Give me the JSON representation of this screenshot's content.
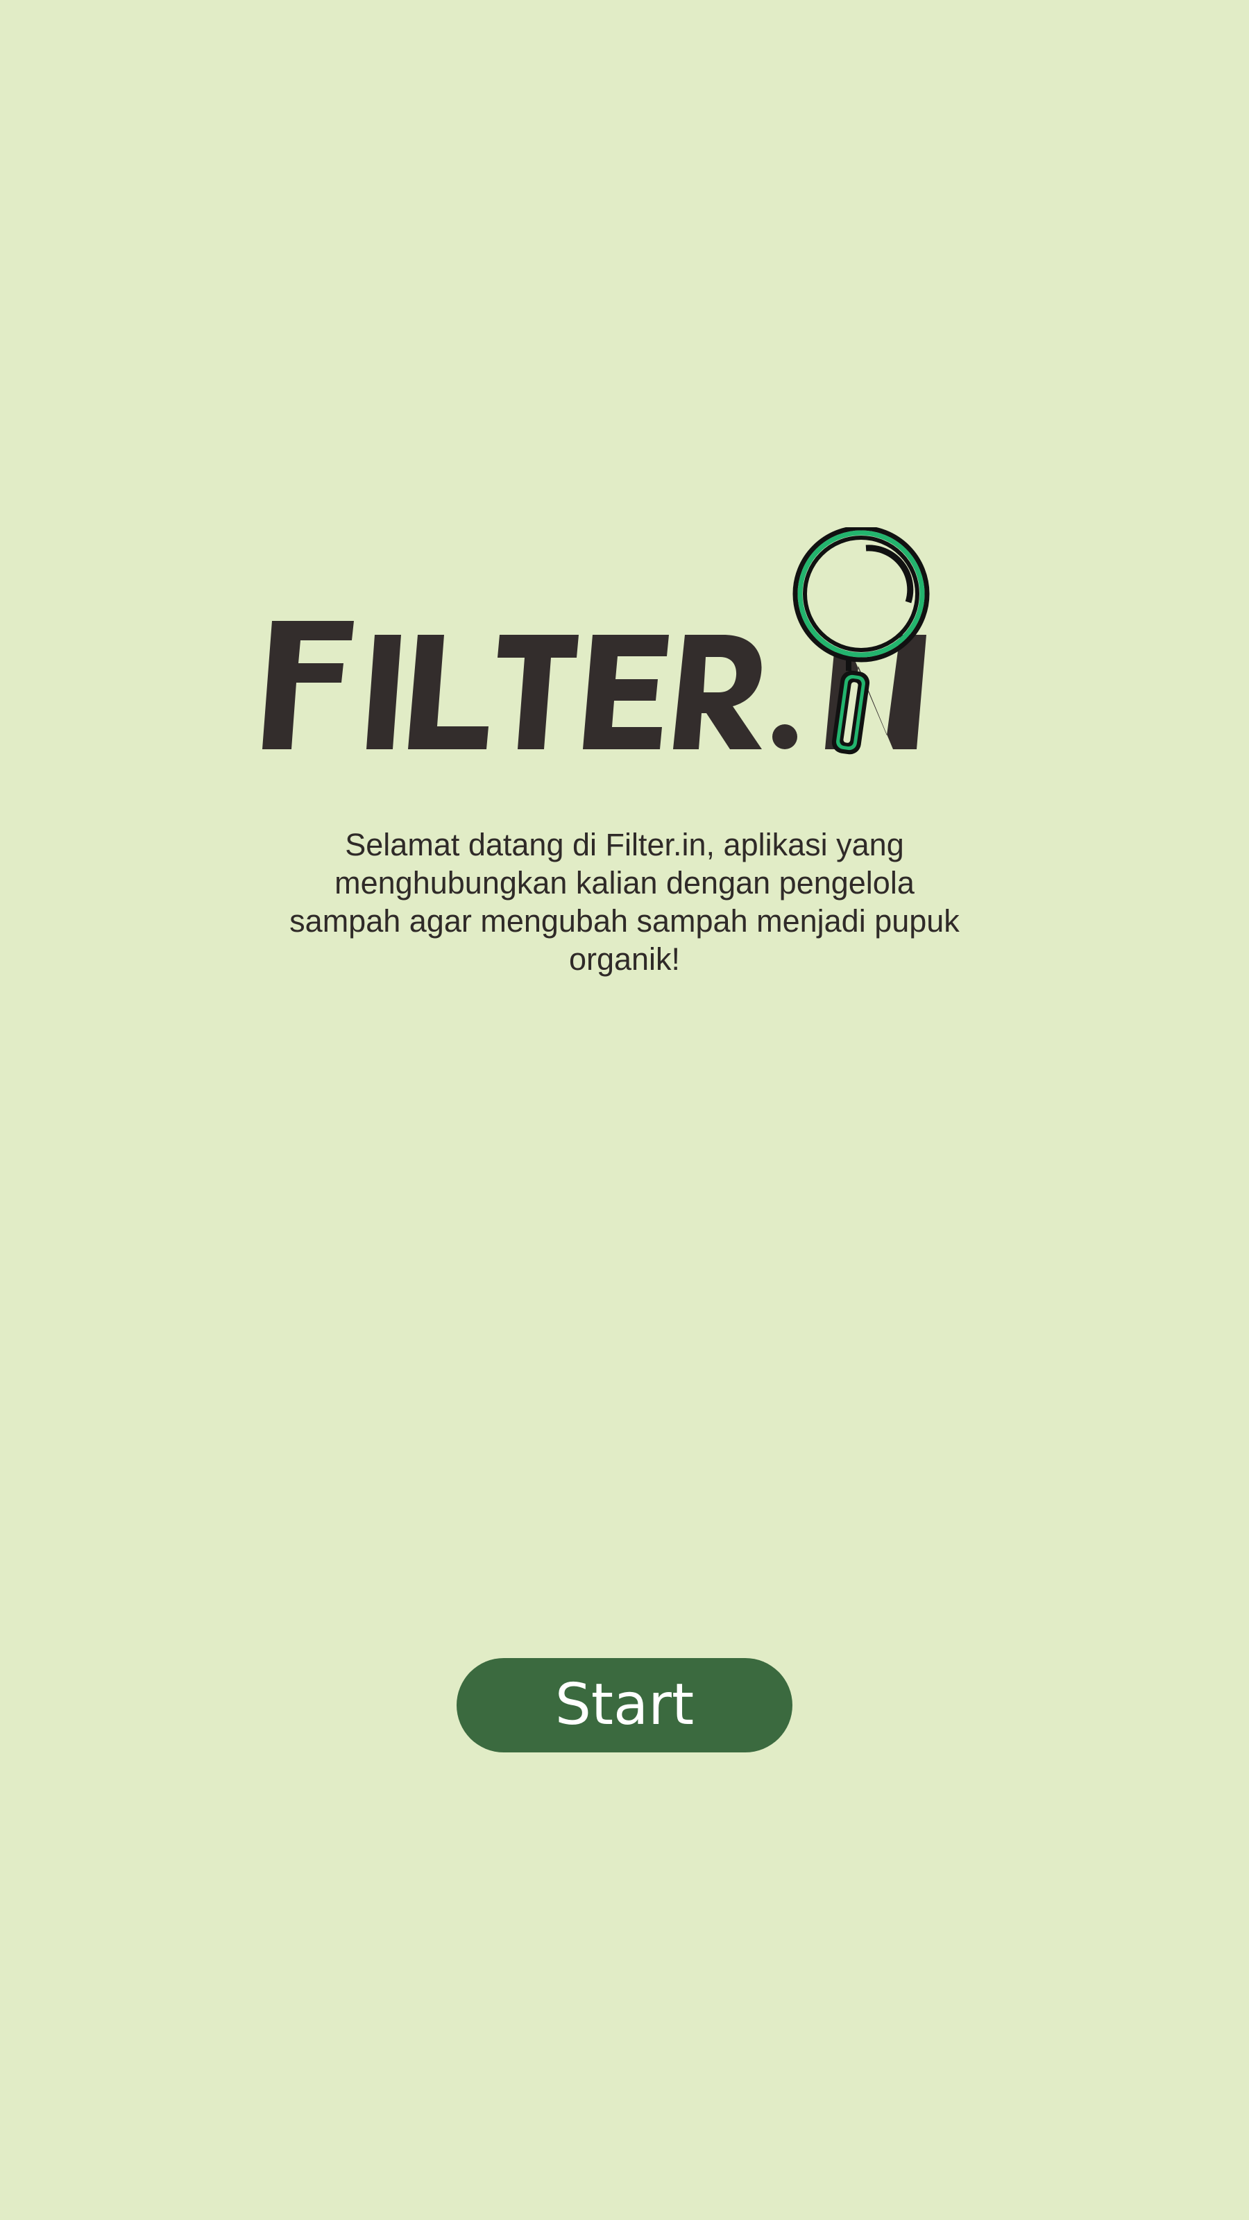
{
  "logo": {
    "text": "Filter.in",
    "icon": "magnifier-icon",
    "text_color": "#332d2c",
    "accent_color": "#23b46e",
    "outline_color": "#111111"
  },
  "welcome": {
    "text": "Selamat datang di Filter.in, aplikasi yang menghubungkan kalian dengan pengelola sampah agar mengubah sampah menjadi pupuk organik!"
  },
  "start_button": {
    "label": "Start"
  },
  "colors": {
    "background": "#e1ecc6",
    "button": "#3b6a3f",
    "button_text": "#ffffff"
  }
}
